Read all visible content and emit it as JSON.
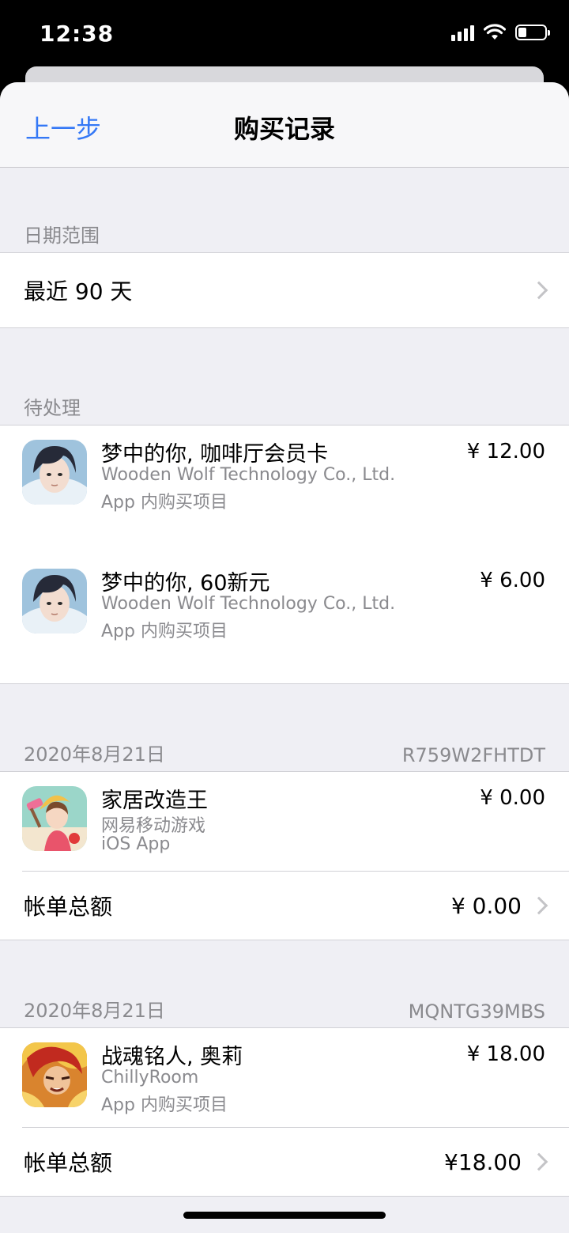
{
  "status_bar": {
    "time": "12:38",
    "battery_level": 0.3
  },
  "nav": {
    "back_label": "上一步",
    "title": "购买记录"
  },
  "date_range": {
    "header": "日期范围",
    "value": "最近 90 天"
  },
  "pending": {
    "header": "待处理",
    "items": [
      {
        "name": "梦中的你, 咖啡厅会员卡",
        "developer": "Wooden Wolf Technology Co., Ltd.",
        "type": "App 内购买项目",
        "price": "¥ 12.00",
        "icon": "dream-you-game-icon"
      },
      {
        "name": "梦中的你, 60新元",
        "developer": "Wooden Wolf Technology Co., Ltd.",
        "type": "App 内购买项目",
        "price": "¥ 6.00",
        "icon": "dream-you-game-icon"
      }
    ]
  },
  "orders": [
    {
      "date": "2020年8月21日",
      "order_id": "R759W2FHTDT",
      "item": {
        "name": "家居改造王",
        "developer": "网易移动游戏",
        "type": "iOS App",
        "price": "¥ 0.00",
        "icon": "home-design-game-icon"
      },
      "total_label": "帐单总额",
      "total": "¥ 0.00"
    },
    {
      "date": "2020年8月21日",
      "order_id": "MQNTG39MBS",
      "item": {
        "name": "战魂铭人, 奥莉",
        "developer": "ChillyRoom",
        "type": "App 内购买项目",
        "price": "¥ 18.00",
        "icon": "otherworld-legends-game-icon"
      },
      "total_label": "帐单总额",
      "total": "¥18.00"
    }
  ]
}
